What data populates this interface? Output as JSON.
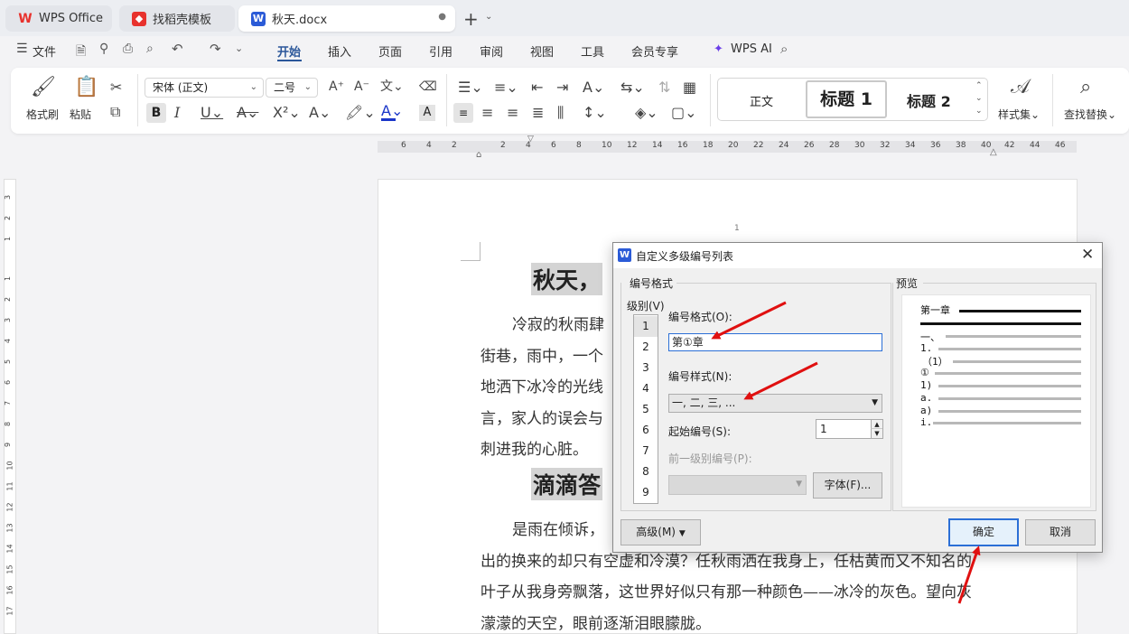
{
  "tabs": [
    {
      "label": "WPS Office",
      "icon": "wps-logo-icon"
    },
    {
      "label": "找稻壳模板",
      "icon": "daoke-icon"
    },
    {
      "label": "秋天.docx",
      "icon": "word-doc-icon"
    }
  ],
  "menu": {
    "file": "文件",
    "items": [
      "开始",
      "插入",
      "页面",
      "引用",
      "审阅",
      "视图",
      "工具",
      "会员专享"
    ],
    "active": "开始",
    "ai": "WPS AI"
  },
  "ribbon": {
    "format_painter": "格式刷",
    "paste": "粘贴",
    "font_name": "宋体 (正文)",
    "font_size": "二号",
    "styles": [
      "正文",
      "标题 1",
      "标题 2"
    ],
    "style_set": "样式集",
    "find_replace": "查找替换"
  },
  "hruler_ticks": [
    "6",
    "4",
    "2",
    "2",
    "4",
    "6",
    "8",
    "10",
    "12",
    "14",
    "16",
    "18",
    "20",
    "22",
    "24",
    "26",
    "28",
    "30",
    "32",
    "34",
    "36",
    "38",
    "40",
    "42",
    "44",
    "46"
  ],
  "vruler_ticks": [
    "3",
    "2",
    "1",
    "1",
    "2",
    "3",
    "4",
    "5",
    "6",
    "7",
    "8",
    "9",
    "10",
    "11",
    "12",
    "13",
    "14",
    "15",
    "16",
    "17",
    "18"
  ],
  "document": {
    "page_number": "1",
    "heading1": "秋天，",
    "para1": [
      "冷寂的秋雨肆",
      "街巷，雨中，一个",
      "地洒下冰冷的光线",
      "言，家人的误会与",
      "刺进我的心脏。"
    ],
    "heading2": "滴滴答",
    "para2": [
      "是雨在倾诉，",
      "出的换来的却只有空虚和冷漠？任秋雨洒在我身上，任枯黄而又不知名的",
      "叶子从我身旁飘落，这世界好似只有那一种颜色——冰冷的灰色。望向灰",
      "濛濛的天空，眼前逐渐泪眼朦胧。"
    ]
  },
  "dialog": {
    "title": "自定义多级编号列表",
    "group_format": "编号格式",
    "level_label": "级别(V)",
    "levels": [
      "1",
      "2",
      "3",
      "4",
      "5",
      "6",
      "7",
      "8",
      "9"
    ],
    "selected_level": "1",
    "format_label": "编号格式(O):",
    "format_value": "第①章",
    "style_label": "编号样式(N):",
    "style_value": "一, 二, 三, ...",
    "start_label": "起始编号(S):",
    "start_value": "1",
    "prev_level_label": "前一级别编号(P):",
    "font_button": "字体(F)...",
    "preview_label": "预览",
    "preview_rows": [
      "第一章",
      "一、",
      "1.",
      "（1）",
      "①",
      "1)",
      "a.",
      "a)",
      "i."
    ],
    "advanced_button": "高级(M)",
    "ok_button": "确定",
    "cancel_button": "取消"
  },
  "colors": {
    "accent": "#2b579a",
    "arrow": "#e01010",
    "tab_active": "#ffffff"
  }
}
